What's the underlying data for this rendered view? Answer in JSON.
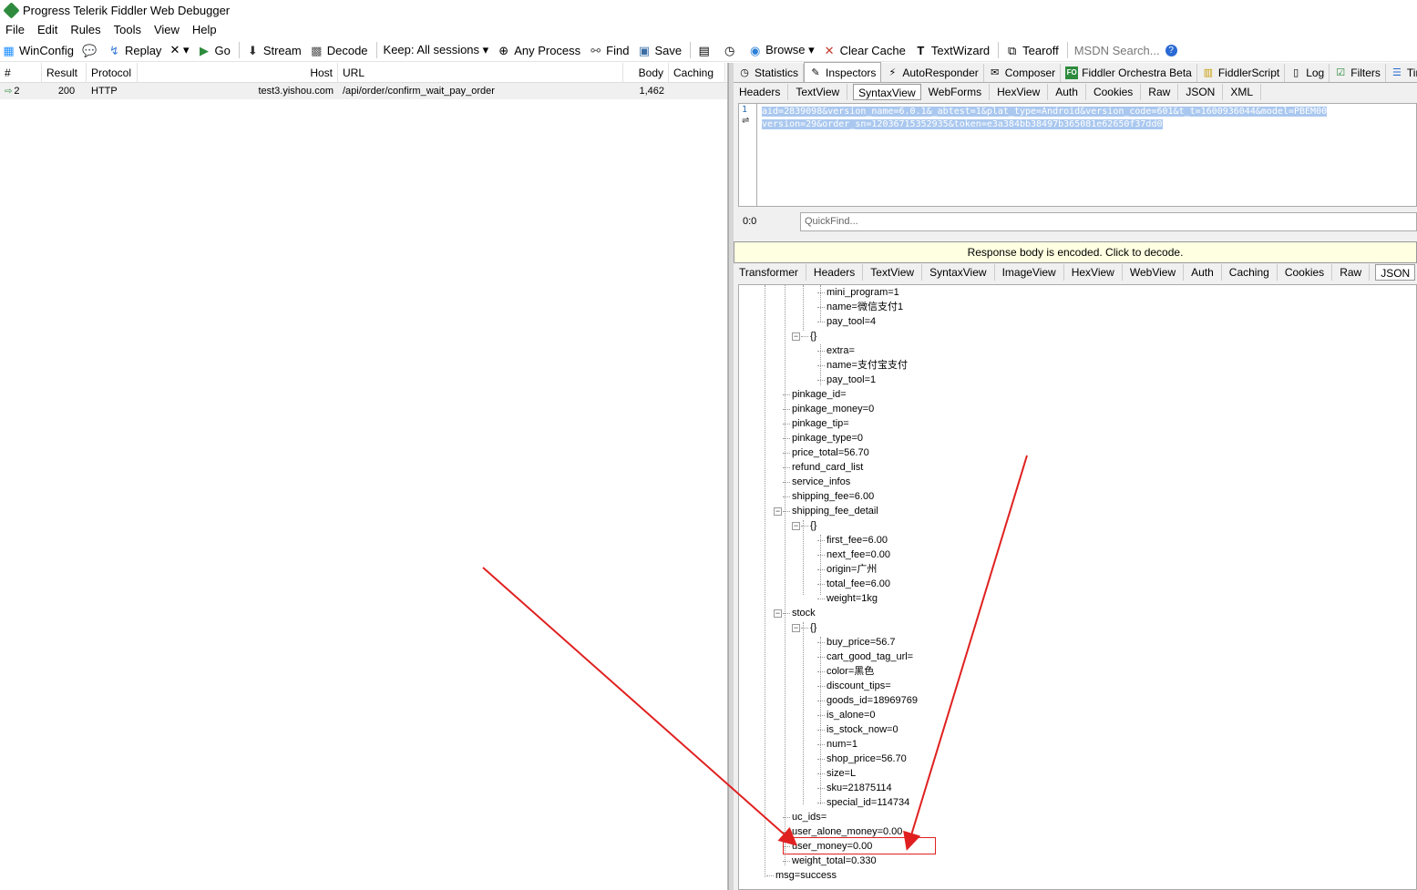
{
  "window": {
    "title": "Progress Telerik Fiddler Web Debugger"
  },
  "menu": [
    "File",
    "Edit",
    "Rules",
    "Tools",
    "View",
    "Help"
  ],
  "toolbar": {
    "winconfig": "WinConfig",
    "replay": "Replay",
    "remove": "✕ ▾",
    "go": "Go",
    "stream": "Stream",
    "decode": "Decode",
    "keep": "Keep: All sessions ▾",
    "any_process": "Any Process",
    "find": "Find",
    "save": "Save",
    "browse": "Browse ▾",
    "clear_cache": "Clear Cache",
    "textwizard": "TextWizard",
    "tearoff": "Tearoff",
    "msdn_search": "MSDN Search..."
  },
  "sessions": {
    "columns": [
      "#",
      "Result",
      "Protocol",
      "Host",
      "URL",
      "Body",
      "Caching"
    ],
    "rows": [
      {
        "num": "2",
        "result": "200",
        "protocol": "HTTP",
        "host": "test3.yishou.com",
        "url": "/api/order/confirm_wait_pay_order",
        "body": "1,462",
        "caching": ""
      }
    ]
  },
  "main_tabs": [
    "Statistics",
    "Inspectors",
    "AutoResponder",
    "Composer",
    "Fiddler Orchestra Beta",
    "FiddlerScript",
    "Log",
    "Filters",
    "Time"
  ],
  "request_tabs": [
    "Headers",
    "TextView",
    "SyntaxView",
    "WebForms",
    "HexView",
    "Auth",
    "Cookies",
    "Raw",
    "JSON",
    "XML"
  ],
  "request_body": {
    "line1": "aid=2839098&version_name=6.0.1&_abtest=1&plat_type=Android&version_code=601&t_t=1600936044&model=PBEM00",
    "line2": "version=29&order_sn=12036715352935&token=e3a384bb38497b365081e62650f37dd0",
    "line_number": "1"
  },
  "position": "0:0",
  "quickfind_placeholder": "QuickFind...",
  "encoded_notice": "Response body is encoded. Click to decode.",
  "response_tabs": [
    "Transformer",
    "Headers",
    "TextView",
    "SyntaxView",
    "ImageView",
    "HexView",
    "WebView",
    "Auth",
    "Caching",
    "Cookies",
    "Raw",
    "JSON"
  ],
  "tree": {
    "nodes": [
      "mini_program=1",
      "name=微信支付1",
      "pay_tool=4",
      "{}",
      "extra=",
      "name=支付宝支付",
      "pay_tool=1",
      "pinkage_id=",
      "pinkage_money=0",
      "pinkage_tip=",
      "pinkage_type=0",
      "price_total=56.70",
      "refund_card_list",
      "service_infos",
      "shipping_fee=6.00",
      "shipping_fee_detail",
      "{}",
      "first_fee=6.00",
      "next_fee=0.00",
      "origin=广州",
      "total_fee=6.00",
      "weight=1kg",
      "stock",
      "{}",
      "buy_price=56.7",
      "cart_good_tag_url=",
      "color=黑色",
      "discount_tips=",
      "goods_id=18969769",
      "is_alone=0",
      "is_stock_now=0",
      "num=1",
      "shop_price=56.70",
      "size=L",
      "sku=21875114",
      "special_id=114734",
      "uc_ids=",
      "user_alone_money=0.00",
      "user_money=0.00",
      "weight_total=0.330",
      "msg=success"
    ]
  },
  "colors": {
    "annotation": "#e02020",
    "selection": "#aac8ef",
    "notice_bg": "#ffffe1"
  }
}
